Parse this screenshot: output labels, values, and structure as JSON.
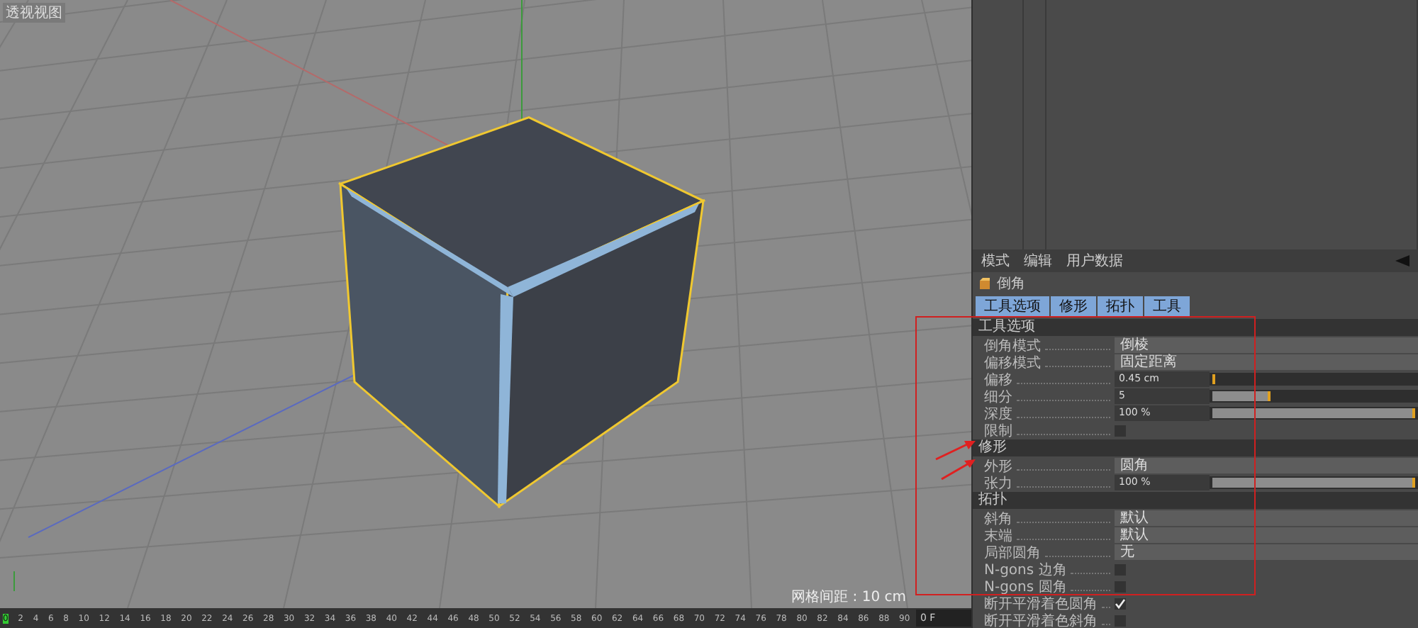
{
  "viewport": {
    "label": "透视视图",
    "grid_spacing": "网格间距 : 10 cm"
  },
  "timeline": {
    "ticks": [
      "0",
      "2",
      "4",
      "6",
      "8",
      "10",
      "12",
      "14",
      "16",
      "18",
      "20",
      "22",
      "24",
      "26",
      "28",
      "30",
      "32",
      "34",
      "36",
      "38",
      "40",
      "42",
      "44",
      "46",
      "48",
      "50",
      "52",
      "54",
      "56",
      "58",
      "60",
      "62",
      "64",
      "66",
      "68",
      "70",
      "72",
      "74",
      "76",
      "78",
      "80",
      "82",
      "84",
      "86",
      "88",
      "90"
    ],
    "frame": "0 F"
  },
  "attributes": {
    "menu": [
      "模式",
      "编辑",
      "用户数据"
    ],
    "title": "倒角",
    "tabs": [
      {
        "label": "工具选项",
        "selected": true
      },
      {
        "label": "修形",
        "selected": true
      },
      {
        "label": "拓扑",
        "selected": true
      },
      {
        "label": "工具",
        "selected": true
      }
    ],
    "sections": [
      {
        "title": "工具选项",
        "rows": [
          {
            "kind": "dropdown",
            "label": "倒角模式",
            "value": "倒棱"
          },
          {
            "kind": "dropdown",
            "label": "偏移模式",
            "value": "固定距离"
          },
          {
            "kind": "slider",
            "label": "偏移",
            "value": "0.45 cm",
            "level": 0.01
          },
          {
            "kind": "slider",
            "label": "细分",
            "value": "5",
            "level": 0.29
          },
          {
            "kind": "slider",
            "label": "深度",
            "value": "100 %",
            "level": 1
          },
          {
            "kind": "checkbox",
            "label": "限制",
            "checked": false
          }
        ]
      },
      {
        "title": "修形",
        "rows": [
          {
            "kind": "dropdown",
            "label": "外形",
            "value": "圆角"
          },
          {
            "kind": "slider",
            "label": "张力",
            "value": "100 %",
            "level": 1
          }
        ]
      },
      {
        "title": "拓扑",
        "rows": [
          {
            "kind": "dropdown",
            "label": "斜角",
            "value": "默认"
          },
          {
            "kind": "dropdown",
            "label": "末端",
            "value": "默认"
          },
          {
            "kind": "dropdown",
            "label": "局部圆角",
            "value": "无"
          },
          {
            "kind": "checkbox",
            "label": "N-gons 边角",
            "checked": false
          },
          {
            "kind": "checkbox",
            "label": "N-gons 圆角",
            "checked": false
          },
          {
            "kind": "checkbox",
            "label": "断开平滑着色圆角",
            "checked": true
          },
          {
            "kind": "checkbox",
            "label": "断开平滑着色斜角",
            "checked": false
          }
        ]
      }
    ]
  }
}
